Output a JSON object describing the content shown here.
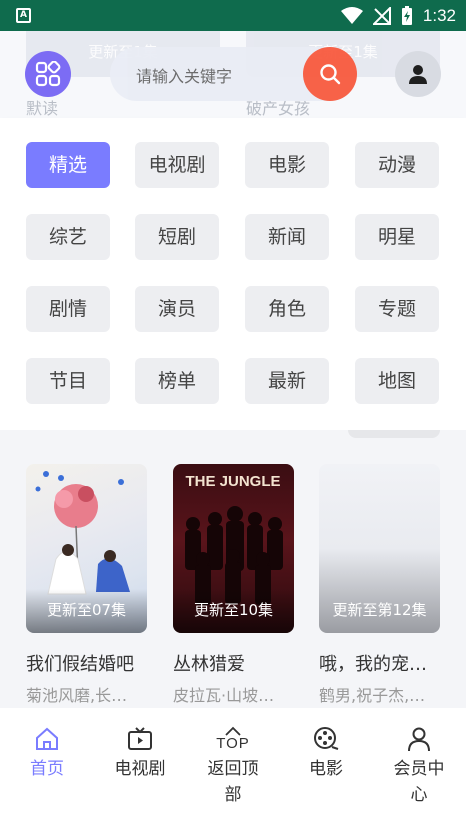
{
  "status_bar": {
    "time": "1:32"
  },
  "background": {
    "cards": [
      "更新至1集",
      "更新至1集"
    ],
    "titles": [
      "默读",
      "破产女孩"
    ]
  },
  "header": {
    "search_placeholder": "请输入关键字"
  },
  "categories": [
    {
      "label": "精选",
      "active": true
    },
    {
      "label": "电视剧",
      "active": false
    },
    {
      "label": "电影",
      "active": false
    },
    {
      "label": "动漫",
      "active": false
    },
    {
      "label": "综艺",
      "active": false
    },
    {
      "label": "短剧",
      "active": false
    },
    {
      "label": "新闻",
      "active": false
    },
    {
      "label": "明星",
      "active": false
    },
    {
      "label": "剧情",
      "active": false
    },
    {
      "label": "演员",
      "active": false
    },
    {
      "label": "角色",
      "active": false
    },
    {
      "label": "专题",
      "active": false
    },
    {
      "label": "节目",
      "active": false
    },
    {
      "label": "榜单",
      "active": false
    },
    {
      "label": "最新",
      "active": false
    },
    {
      "label": "地图",
      "active": false
    }
  ],
  "videos": [
    {
      "badge": "更新至07集",
      "title": "我们假结婚吧",
      "cast": "菊池风磨,长…"
    },
    {
      "badge": "更新至10集",
      "title": "丛林猎爱",
      "cast": "皮拉瓦·山坡…"
    },
    {
      "badge": "更新至第12集",
      "title": "哦，我的宠…",
      "cast": "鹤男,祝子杰,…"
    }
  ],
  "nav": [
    {
      "label": "首页",
      "icon": "home-icon",
      "active": true
    },
    {
      "label": "电视剧",
      "icon": "tv-icon",
      "active": false
    },
    {
      "label": "返回顶部",
      "icon": "back-to-top-icon",
      "top_text": "TOP",
      "active": false
    },
    {
      "label": "电影",
      "icon": "film-reel-icon",
      "active": false
    },
    {
      "label": "会员中心",
      "icon": "user-center-icon",
      "active": false
    }
  ],
  "colors": {
    "accent": "#7a7cff",
    "search_button": "#f85a3f",
    "status_bar": "#0f6b4d"
  }
}
